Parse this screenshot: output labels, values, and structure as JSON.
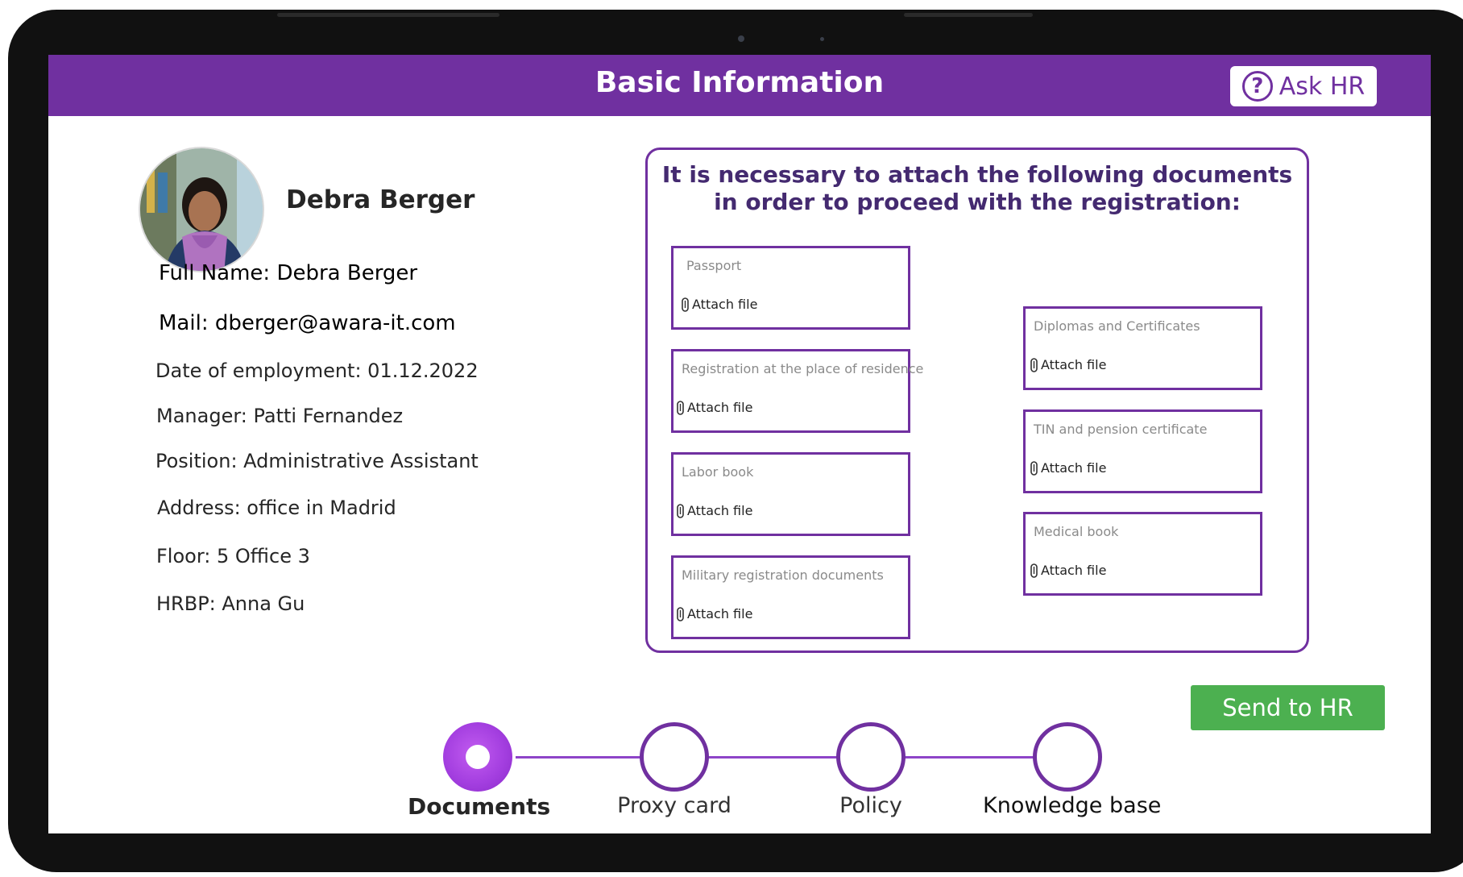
{
  "header": {
    "title": "Basic Information",
    "ask_hr_label": "Ask HR"
  },
  "profile": {
    "name": "Debra Berger",
    "full_name": "Full Name: Debra Berger",
    "mail": "Mail: dberger@awara-it.com",
    "date_of_employment": "Date of employment: 01.12.2022",
    "manager": "Manager: Patti Fernandez",
    "position": "Position: Administrative Assistant",
    "address": "Address: office in Madrid",
    "floor": "Floor: 5 Office 3",
    "hrbp": "HRBP: Anna Gu"
  },
  "documents": {
    "instruction": "It is necessary to attach the following documents in order to proceed with the registration:",
    "attach_label": "Attach file",
    "left": [
      {
        "label": "Passport"
      },
      {
        "label": "Registration at the place of residence"
      },
      {
        "label": "Labor book"
      },
      {
        "label": "Military registration documents"
      }
    ],
    "right": [
      {
        "label": "Diplomas and Certificates"
      },
      {
        "label": "TIN and pension certificate"
      },
      {
        "label": "Medical book"
      }
    ]
  },
  "send_button": "Send to HR",
  "steps": [
    {
      "label": "Documents",
      "active": true
    },
    {
      "label": "Proxy card",
      "active": false
    },
    {
      "label": "Policy",
      "active": false
    },
    {
      "label": "Knowledge base",
      "active": false
    }
  ],
  "colors": {
    "brand": "#7030a0",
    "send": "#4cb050",
    "step_active": "#a43fe0"
  }
}
